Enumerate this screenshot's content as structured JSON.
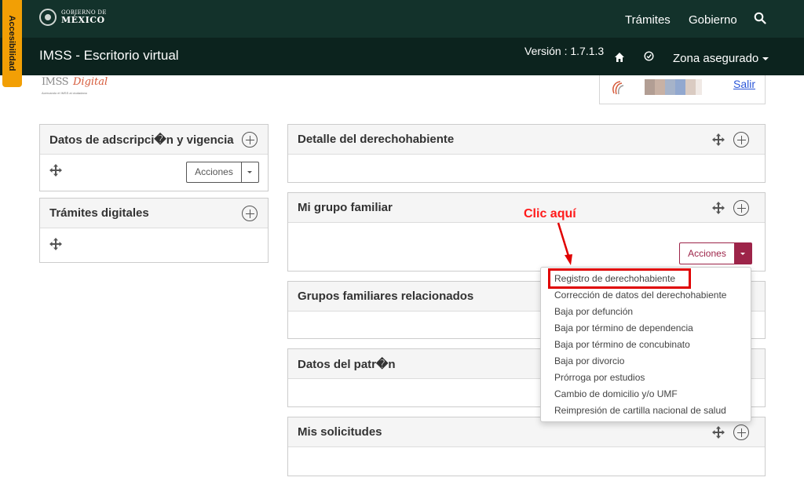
{
  "accessibility": {
    "label": "Accesibilidad"
  },
  "gov_header": {
    "logo_line1": "GOBIERNO DE",
    "logo_line2": "MÉXICO",
    "nav": [
      "Trámites",
      "Gobierno"
    ],
    "search_icon": "search-icon"
  },
  "app_header": {
    "title": "IMSS - Escritorio virtual",
    "version": "Versión : 1.7.1.3",
    "zona": "Zona asegurado"
  },
  "imss_logo": {
    "text_imss": "IMSS",
    "text_digital": "Digital",
    "tagline": "Acercando el IMSS al ciudadano"
  },
  "user": {
    "logout": "Salir"
  },
  "left_panels": [
    {
      "title": "Datos de adscripci�n y vigencia",
      "button": "Acciones"
    },
    {
      "title": "Trámites digitales"
    }
  ],
  "right_panels": [
    {
      "title": "Detalle del derechohabiente"
    },
    {
      "title": "Mi grupo familiar",
      "button": "Acciones"
    },
    {
      "title": "Grupos familiares relacionados"
    },
    {
      "title": "Datos del patr�n"
    },
    {
      "title": "Mis solicitudes"
    }
  ],
  "dropdown_items": [
    "Registro de derechohabiente",
    "Corrección de datos del derechohabiente",
    "Baja por defunción",
    "Baja por término de dependencia",
    "Baja por término de concubinato",
    "Baja por divorcio",
    "Prórroga por estudios",
    "Cambio de domicilio y/o UMF",
    "Reimpresión de cartilla nacional de salud"
  ],
  "annotation": {
    "text": "Clic aquí"
  },
  "colors": {
    "gov_green": "#13322b",
    "app_green": "#0c231e",
    "accent_wine": "#9d2449",
    "accessibility_orange": "#f29f05",
    "annotation_red": "#ff1a1a"
  }
}
